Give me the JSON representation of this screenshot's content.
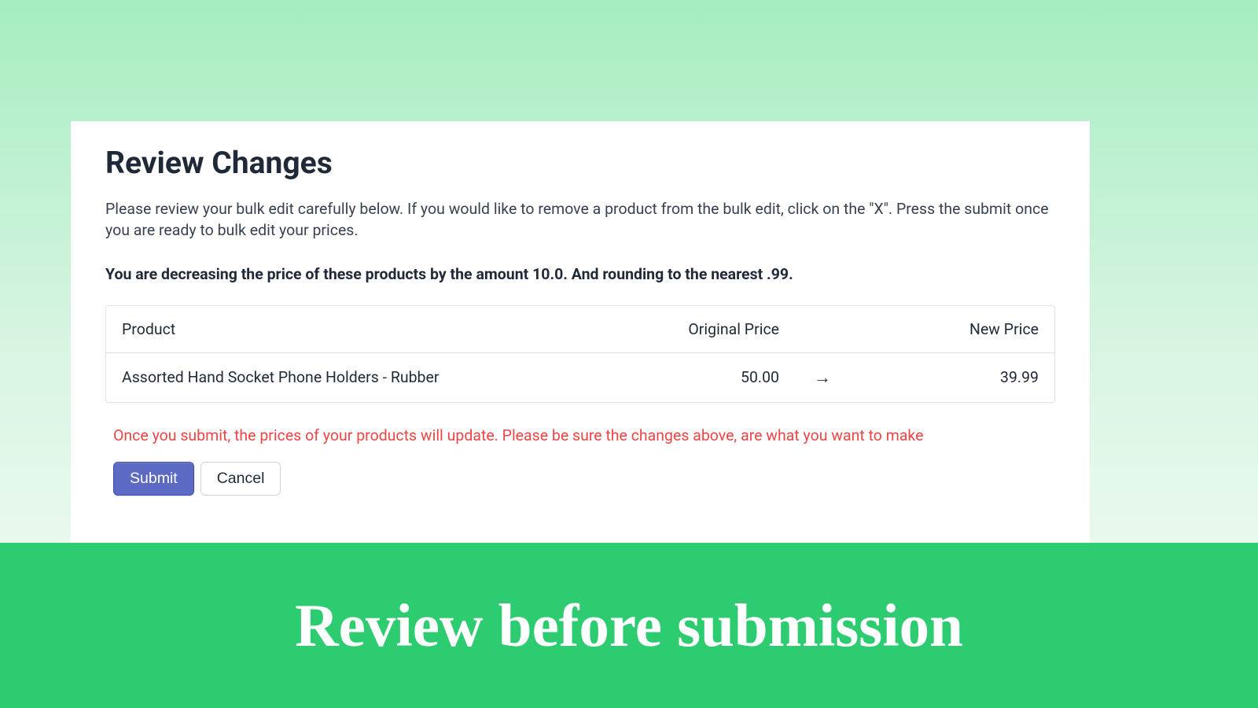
{
  "header": {
    "title": "Review Changes",
    "description": "Please review your bulk edit carefully below. If you would like to remove a product from the bulk edit, click on the \"X\". Press the submit once you are ready to bulk edit your prices.",
    "summary": "You are decreasing the price of these products by the amount 10.0. And rounding to the nearest .99."
  },
  "table": {
    "columns": {
      "product": "Product",
      "original": "Original Price",
      "new": "New Price"
    },
    "rows": [
      {
        "product": "Assorted Hand Socket Phone Holders - Rubber",
        "original": "50.00",
        "arrow": "→",
        "new": "39.99"
      }
    ]
  },
  "warning": "Once you submit, the prices of your products will update. Please be sure the changes above, are what you want to make",
  "actions": {
    "submit": "Submit",
    "cancel": "Cancel"
  },
  "banner": "Review before submission"
}
